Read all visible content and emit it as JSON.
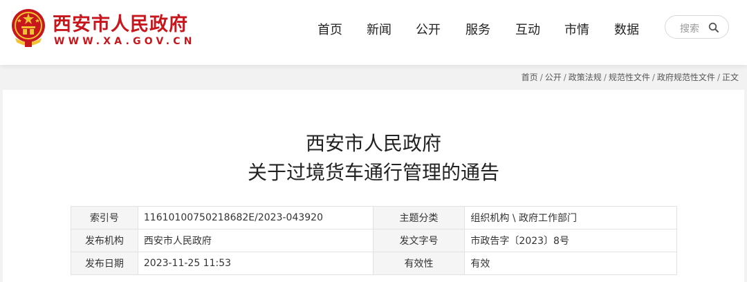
{
  "site": {
    "title": "西安市人民政府",
    "url": "WWW.XA.GOV.CN",
    "brand_color": "#c8161d",
    "emblem_icon": "national-emblem-icon"
  },
  "nav": {
    "items": [
      "首页",
      "新闻",
      "公开",
      "服务",
      "互动",
      "市情",
      "数据"
    ]
  },
  "search": {
    "placeholder": "搜索",
    "icon": "search-icon"
  },
  "breadcrumb": {
    "items": [
      "首页",
      "公开",
      "政策法规",
      "规范性文件",
      "政府规范性文件",
      "正文"
    ],
    "separator": "/"
  },
  "document": {
    "title_line1": "西安市人民政府",
    "title_line2": "关于过境货车通行管理的通告"
  },
  "info": {
    "index_label": "索引号",
    "index_value": "11610100750218682E/2023-043920",
    "topic_label": "主题分类",
    "topic_value": "组织机构 \\ 政府工作部门",
    "publisher_label": "发布机构",
    "publisher_value": "西安市人民政府",
    "docno_label": "发文字号",
    "docno_value": "市政告字〔2023〕8号",
    "date_label": "发布日期",
    "date_value": "2023-11-25 11:53",
    "validity_label": "有效性",
    "validity_value": "有效"
  }
}
